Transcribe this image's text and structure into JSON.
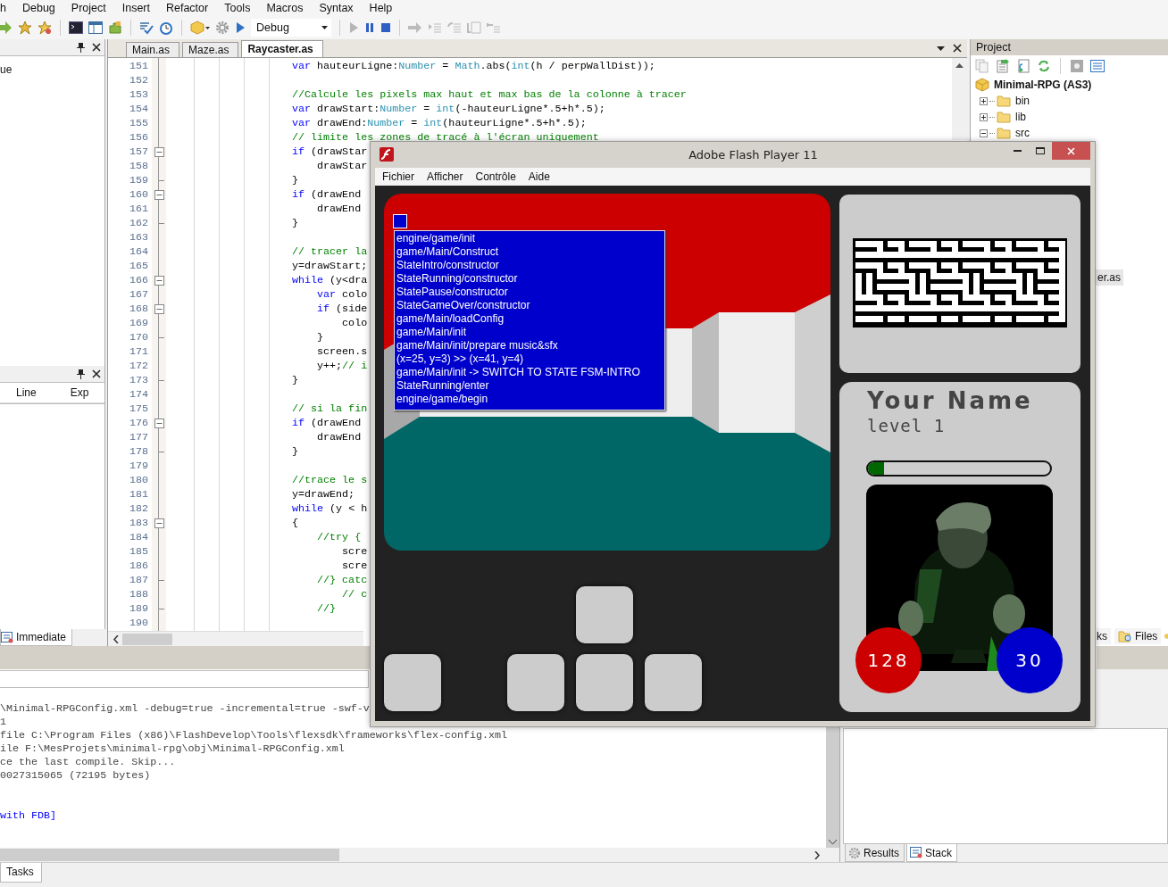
{
  "menu": [
    "h",
    "Debug",
    "Project",
    "Insert",
    "Refactor",
    "Tools",
    "Macros",
    "Syntax",
    "Help"
  ],
  "toolbar": {
    "config": "Debug"
  },
  "left_panels": {
    "top_item": "ue",
    "columns": [
      "Line",
      "Exp"
    ],
    "tab": "Immediate"
  },
  "editor": {
    "tabs": [
      {
        "label": "Main.as",
        "selected": false
      },
      {
        "label": "Maze.as",
        "selected": false
      },
      {
        "label": "Raycaster.as",
        "selected": true
      }
    ],
    "lines": [
      {
        "num": "151",
        "kind": "plain",
        "code": [
          {
            "kind": "keyword",
            "text": "var"
          },
          {
            "kind": "plain",
            "text": " hauteurLigne:"
          },
          {
            "kind": "type",
            "text": "Number"
          },
          {
            "kind": "plain",
            "text": " = "
          },
          {
            "kind": "type",
            "text": "Math"
          },
          {
            "kind": "plain",
            "text": ".abs("
          },
          {
            "kind": "type",
            "text": "int"
          },
          {
            "kind": "plain",
            "text": "(h / perpWallDist));"
          }
        ]
      },
      {
        "num": "152",
        "kind": "plain"
      },
      {
        "num": "153",
        "kind": "plain",
        "code": [
          {
            "kind": "comment",
            "text": "//Calcule les pixels max haut et max bas de la colonne à tracer"
          }
        ]
      },
      {
        "num": "154",
        "kind": "plain",
        "code": [
          {
            "kind": "keyword",
            "text": "var"
          },
          {
            "kind": "plain",
            "text": " drawStart:"
          },
          {
            "kind": "type",
            "text": "Number"
          },
          {
            "kind": "plain",
            "text": " = "
          },
          {
            "kind": "type",
            "text": "int"
          },
          {
            "kind": "plain",
            "text": "(-hauteurLigne*.5+h*.5);"
          }
        ]
      },
      {
        "num": "155",
        "kind": "plain",
        "code": [
          {
            "kind": "keyword",
            "text": "var"
          },
          {
            "kind": "plain",
            "text": " drawEnd:"
          },
          {
            "kind": "type",
            "text": "Number"
          },
          {
            "kind": "plain",
            "text": " = "
          },
          {
            "kind": "type",
            "text": "int"
          },
          {
            "kind": "plain",
            "text": "(hauteurLigne*.5+h*.5);"
          }
        ]
      },
      {
        "num": "156",
        "kind": "plain",
        "code": [
          {
            "kind": "comment",
            "text": "// limite les zones de tracé à l'écran uniquement"
          }
        ]
      },
      {
        "num": "157",
        "kind": "opener",
        "code": [
          {
            "kind": "keyword",
            "text": "if"
          },
          {
            "kind": "plain",
            "text": " (drawStar"
          }
        ]
      },
      {
        "num": "158",
        "kind": "plain",
        "code": [
          {
            "kind": "plain",
            "text": "    drawStar"
          }
        ]
      },
      {
        "num": "159",
        "kind": "closer",
        "code": [
          {
            "kind": "plain",
            "text": "}"
          }
        ]
      },
      {
        "num": "160",
        "kind": "opener",
        "code": [
          {
            "kind": "keyword",
            "text": "if"
          },
          {
            "kind": "plain",
            "text": " (drawEnd"
          }
        ]
      },
      {
        "num": "161",
        "kind": "plain",
        "code": [
          {
            "kind": "plain",
            "text": "    drawEnd"
          }
        ]
      },
      {
        "num": "162",
        "kind": "closer",
        "code": [
          {
            "kind": "plain",
            "text": "}"
          }
        ]
      },
      {
        "num": "163",
        "kind": "plain"
      },
      {
        "num": "164",
        "kind": "plain",
        "code": [
          {
            "kind": "comment",
            "text": "// tracer la"
          }
        ]
      },
      {
        "num": "165",
        "kind": "plain",
        "code": [
          {
            "kind": "plain",
            "text": "y=drawStart;"
          }
        ]
      },
      {
        "num": "166",
        "kind": "opener",
        "code": [
          {
            "kind": "keyword",
            "text": "while"
          },
          {
            "kind": "plain",
            "text": " (y<dra"
          }
        ]
      },
      {
        "num": "167",
        "kind": "plain",
        "code": [
          {
            "kind": "keyword",
            "text": "    var"
          },
          {
            "kind": "plain",
            "text": " colo"
          }
        ]
      },
      {
        "num": "168",
        "kind": "opener",
        "code": [
          {
            "kind": "keyword",
            "text": "    if"
          },
          {
            "kind": "plain",
            "text": " (side"
          }
        ]
      },
      {
        "num": "169",
        "kind": "plain",
        "code": [
          {
            "kind": "plain",
            "text": "        colo"
          }
        ]
      },
      {
        "num": "170",
        "kind": "closer",
        "code": [
          {
            "kind": "plain",
            "text": "    }"
          }
        ]
      },
      {
        "num": "171",
        "kind": "plain",
        "code": [
          {
            "kind": "plain",
            "text": "    screen.s"
          }
        ]
      },
      {
        "num": "172",
        "kind": "plain",
        "code": [
          {
            "kind": "plain",
            "text": "    y++;"
          },
          {
            "kind": "comment",
            "text": "// i"
          }
        ]
      },
      {
        "num": "173",
        "kind": "closer",
        "code": [
          {
            "kind": "plain",
            "text": "}"
          }
        ]
      },
      {
        "num": "174",
        "kind": "plain"
      },
      {
        "num": "175",
        "kind": "plain",
        "code": [
          {
            "kind": "comment",
            "text": "// si la fin"
          }
        ]
      },
      {
        "num": "176",
        "kind": "opener",
        "code": [
          {
            "kind": "keyword",
            "text": "if"
          },
          {
            "kind": "plain",
            "text": " (drawEnd"
          }
        ]
      },
      {
        "num": "177",
        "kind": "plain",
        "code": [
          {
            "kind": "plain",
            "text": "    drawEnd"
          }
        ]
      },
      {
        "num": "178",
        "kind": "closer",
        "code": [
          {
            "kind": "plain",
            "text": "}"
          }
        ]
      },
      {
        "num": "179",
        "kind": "plain"
      },
      {
        "num": "180",
        "kind": "plain",
        "code": [
          {
            "kind": "comment",
            "text": "//trace le s"
          }
        ]
      },
      {
        "num": "181",
        "kind": "plain",
        "code": [
          {
            "kind": "plain",
            "text": "y=drawEnd;"
          }
        ]
      },
      {
        "num": "182",
        "kind": "plain",
        "code": [
          {
            "kind": "keyword",
            "text": "while"
          },
          {
            "kind": "plain",
            "text": " (y < h"
          }
        ]
      },
      {
        "num": "183",
        "kind": "opener",
        "code": [
          {
            "kind": "plain",
            "text": "{"
          }
        ]
      },
      {
        "num": "184",
        "kind": "plain",
        "code": [
          {
            "kind": "comment",
            "text": "    //try {"
          }
        ]
      },
      {
        "num": "185",
        "kind": "plain",
        "code": [
          {
            "kind": "plain",
            "text": "        scre"
          }
        ]
      },
      {
        "num": "186",
        "kind": "plain",
        "code": [
          {
            "kind": "plain",
            "text": "        scre"
          }
        ]
      },
      {
        "num": "187",
        "kind": "closer",
        "code": [
          {
            "kind": "comment",
            "text": "    //} catc"
          }
        ]
      },
      {
        "num": "188",
        "kind": "plain",
        "code": [
          {
            "kind": "comment",
            "text": "        // c"
          }
        ]
      },
      {
        "num": "189",
        "kind": "closer",
        "code": [
          {
            "kind": "comment",
            "text": "    //}"
          }
        ]
      },
      {
        "num": "190",
        "kind": "plain"
      }
    ]
  },
  "project": {
    "title": "Project",
    "tree": [
      {
        "label": "Minimal-RPG (AS3)",
        "selected": false,
        "children": [
          {
            "label": "bin",
            "expanded": false,
            "selected": false
          },
          {
            "label": "lib",
            "expanded": false,
            "selected": false
          },
          {
            "label": "src",
            "expanded": true,
            "selected": false,
            "children": [
              {
                "label": "er.as",
                "selected": true
              }
            ]
          }
        ]
      }
    ],
    "tabs": [
      "ks",
      "Files"
    ]
  },
  "output": {
    "lines": [
      {
        "kind": "plain",
        "text": "\\Minimal-RPGConfig.xml -debug=true -incremental=true -swf-v"
      },
      {
        "kind": "plain",
        "text": "1"
      },
      {
        "kind": "plain",
        "text": "file C:\\Program Files (x86)\\FlashDevelop\\Tools\\flexsdk\\frameworks\\flex-config.xml"
      },
      {
        "kind": "plain",
        "text": "ile F:\\MesProjets\\minimal-rpg\\obj\\Minimal-RPGConfig.xml"
      },
      {
        "kind": "plain",
        "text": "ce the last compile. Skip..."
      },
      {
        "kind": "plain",
        "text": "0027315065 (72195 bytes)"
      },
      {
        "kind": "fdb",
        "text": "with FDB]"
      }
    ]
  },
  "results": {
    "tabs": [
      {
        "label": "Results",
        "selected": false
      },
      {
        "label": "Stack",
        "selected": true
      }
    ]
  },
  "bottom_tab": "Tasks",
  "flash": {
    "title": "Adobe Flash Player 11",
    "menu": [
      "Fichier",
      "Afficher",
      "Contrôle",
      "Aide"
    ],
    "trace": [
      "engine/game/init",
      "game/Main/Construct",
      "StateIntro/constructor",
      "StateRunning/constructor",
      "StatePause/constructor",
      "StateGameOver/constructor",
      "game/Main/loadConfig",
      "game/Main/init",
      "game/Main/init/prepare music&sfx",
      "(x=25, y=3) >> (x=41, y=4)",
      "game/Main/init -> SWITCH TO STATE FSM-INTRO",
      "StateRunning/enter",
      "engine/game/begin"
    ],
    "player": {
      "name": "Your Name",
      "rank": "level 1",
      "xp": {
        "level": 0.09
      },
      "health": "128",
      "mana": "30"
    }
  }
}
